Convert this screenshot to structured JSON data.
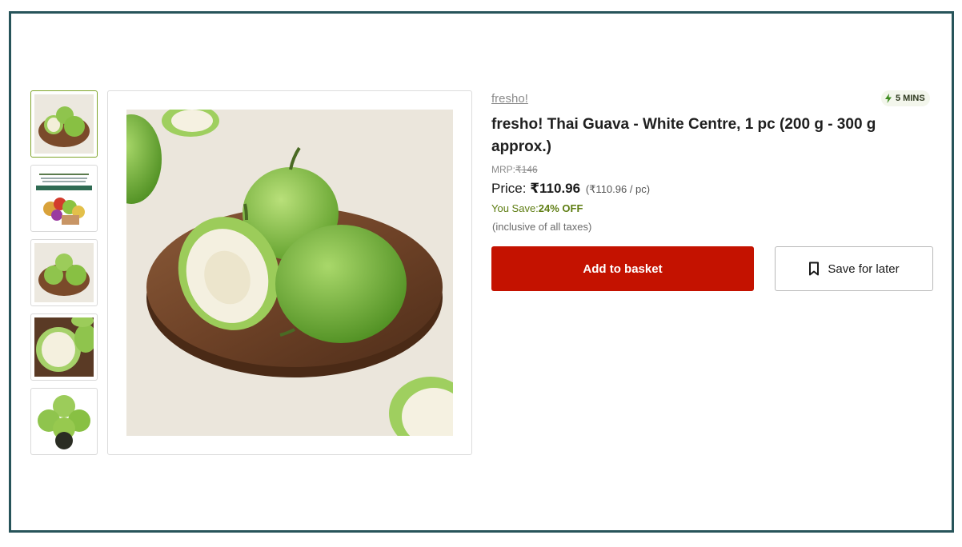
{
  "product": {
    "brand": "fresho!",
    "title": "fresho! Thai Guava - White Centre, 1 pc (200 g - 300 g approx.)",
    "delivery_badge": "5 MINS",
    "mrp_label": "MRP:",
    "mrp_value": "₹146",
    "price_label": "Price:",
    "price_value": "₹110.96",
    "price_per_unit": "(₹110.96 / pc)",
    "you_save_label": "You Save:",
    "you_save_value": "24% OFF",
    "tax_note": "(inclusive of all taxes)"
  },
  "actions": {
    "add_to_basket": "Add to basket",
    "save_for_later": "Save for later"
  },
  "gallery": {
    "thumbnail_count": 5,
    "active_index": 0
  },
  "icons": {
    "delivery": "lightning-icon",
    "save": "bookmark-icon",
    "scroll": "chevron-down-icon"
  },
  "colors": {
    "frame": "#27545a",
    "primary_button": "#c41200",
    "save_text": "#5e7d12"
  }
}
